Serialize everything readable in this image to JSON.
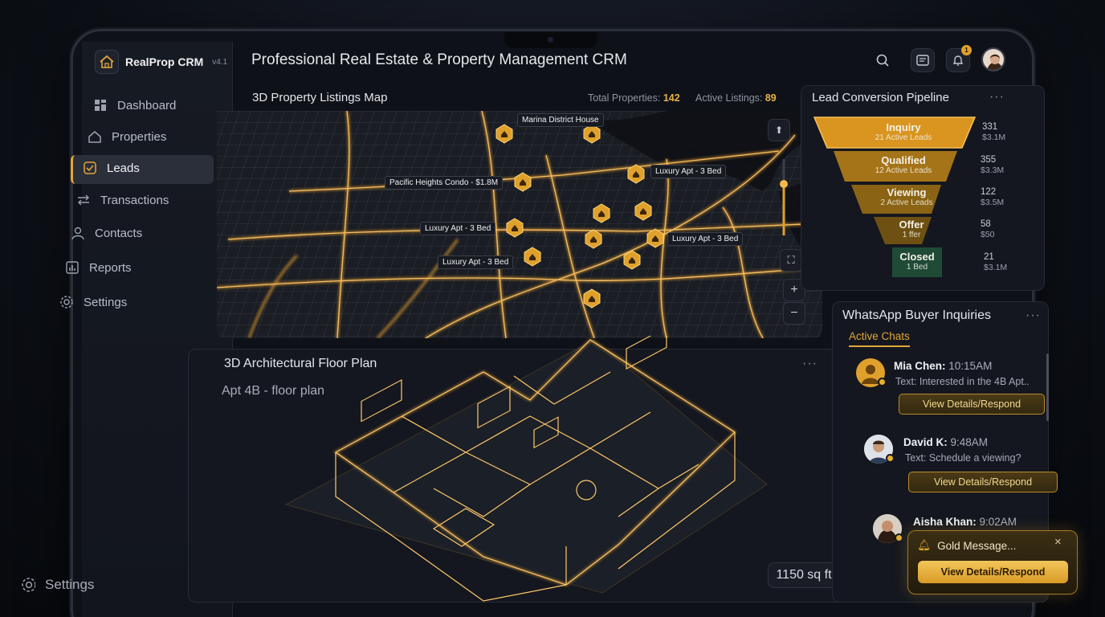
{
  "app": {
    "name": "RealProp CRM",
    "version": "v4.1",
    "title": "Professional Real Estate & Property Management CRM"
  },
  "sidebar": {
    "items": [
      {
        "label": "Dashboard",
        "icon": "grid-icon"
      },
      {
        "label": "Properties",
        "icon": "home-icon"
      },
      {
        "label": "Leads",
        "icon": "checkbox-icon",
        "active": true
      },
      {
        "label": "Transactions",
        "icon": "swap-icon"
      },
      {
        "label": "Contacts",
        "icon": "user-icon"
      },
      {
        "label": "Reports",
        "icon": "chart-icon"
      },
      {
        "label": "Settings",
        "icon": "gear-icon"
      }
    ],
    "bottom_settings": "Settings"
  },
  "header": {
    "notifications_count": "1"
  },
  "map_panel": {
    "title": "3D Property Listings Map",
    "total_label": "Total Properties:",
    "total_value": "142",
    "active_label": "Active Listings:",
    "active_value": "89",
    "labels": [
      "Marina District House",
      "Pacific Heights Condo - $1.8M",
      "Luxury Apt - 3 Bed",
      "Luxury Apt - 3 Bed",
      "Luxury Apt - 3 Bed",
      "Luxury Apt - 3 Bed"
    ],
    "zoom_in": "+",
    "zoom_out": "−"
  },
  "funnel": {
    "title": "Lead Conversion Pipeline",
    "stages": [
      {
        "name": "Inquiry",
        "sub": "21 Active Leads",
        "count": "331",
        "value": "$3.1M"
      },
      {
        "name": "Qualified",
        "sub": "12 Active Leads",
        "count": "355",
        "value": "$3.3M"
      },
      {
        "name": "Viewing",
        "sub": "2 Active Leads",
        "count": "122",
        "value": "$3.5M"
      },
      {
        "name": "Offer",
        "sub": "1 ffer",
        "count": "58",
        "value": "$50"
      },
      {
        "name": "Closed",
        "sub": "1 Bed",
        "count": "21",
        "value": "$3.1M"
      }
    ]
  },
  "floorplan": {
    "title": "3D Architectural Floor Plan",
    "subtitle": "Apt 4B - floor plan",
    "area": "1150 sq ft"
  },
  "chats": {
    "title": "WhatsApp Buyer Inquiries",
    "tab": "Active Chats",
    "items": [
      {
        "name": "Mia Chen:",
        "time": "10:15AM",
        "text": "Text: Interested in the 4B Apt..",
        "button": "View Details/Respond"
      },
      {
        "name": "David K:",
        "time": "9:48AM",
        "text": "Text: Schedule a viewing?",
        "button": "View Details/Respond"
      },
      {
        "name": "Aisha Khan:",
        "time": "9:02AM"
      }
    ],
    "toast": {
      "text": "Gold Message...",
      "button": "View Details/Respond",
      "close": "×"
    }
  },
  "colors": {
    "accent": "#e3a53a",
    "panel": "#14171f",
    "background": "#0e1118"
  }
}
